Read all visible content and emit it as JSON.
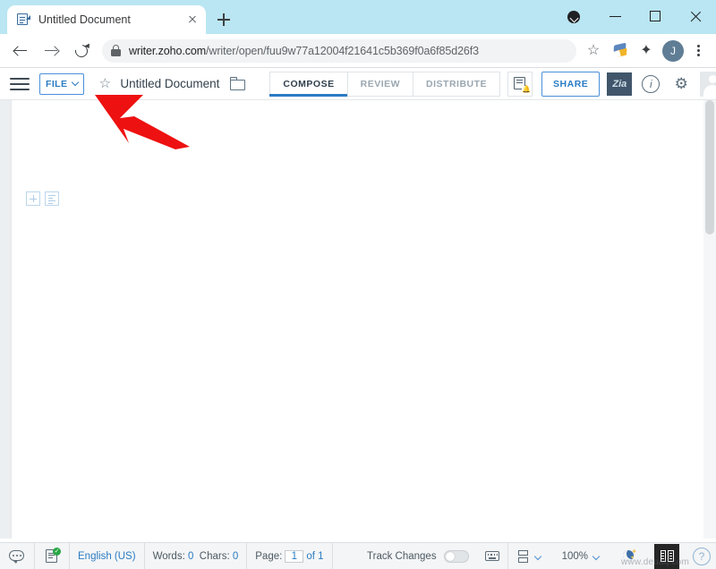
{
  "browser": {
    "tab": {
      "title": "Untitled Document",
      "favicon": "document-icon",
      "close": "×"
    },
    "new_tab_label": "+",
    "window_controls": {
      "tab_search": "tab-search-icon",
      "minimize": "−",
      "maximize": "□",
      "close": "×"
    },
    "nav": {
      "back": "back-arrow-icon",
      "forward": "forward-arrow-icon",
      "reload": "reload-icon"
    },
    "omnibox": {
      "lock": "lock-icon",
      "url_domain": "writer.zoho.com",
      "url_path": "/writer/open/fuu9w77a12004f21641c5b369f0a6f85d26f3",
      "bookmark_star": "☆"
    },
    "extensions": {
      "highlighter": "highlighter-extension-icon",
      "puzzle": "✦"
    },
    "profile_initial": "J",
    "menu": "kebab-menu-icon"
  },
  "app": {
    "menu_icon": "hamburger-menu-icon",
    "file_button": {
      "label": "FILE",
      "chevron": "chevron-down-icon"
    },
    "favorite_star": "☆",
    "document_title": "Untitled Document",
    "folder_icon": "folder-icon",
    "mode_tabs": [
      {
        "label": "COMPOSE",
        "active": true
      },
      {
        "label": "REVIEW",
        "active": false
      },
      {
        "label": "DISTRIBUTE",
        "active": false
      }
    ],
    "notifications_icon": "document-notification-icon",
    "share_button": "SHARE",
    "zia_button": "Zia",
    "info_icon": "i",
    "settings_icon": "⚙",
    "avatar": "user-avatar-icon"
  },
  "document": {
    "insert_tool": "add-block-icon",
    "paragraph_tool": "paragraph-settings-icon"
  },
  "annotation": {
    "arrow_color": "#ee1111",
    "points_to": "file-button"
  },
  "statusbar": {
    "comment_icon": "comment-icon",
    "spellcheck_icon": "spellcheck-ok-icon",
    "spellcheck_badge": "✓",
    "language": "English (US)",
    "words_label": "Words:",
    "words_value": "0",
    "chars_label": "Chars:",
    "chars_value": "0",
    "page_label": "Page:",
    "page_current": "1",
    "page_of": "of 1",
    "track_changes_label": "Track Changes",
    "track_changes_state": "off",
    "keyboard_icon": "keyboard-icon",
    "page_layout_icon": "page-layout-icon",
    "layout_chevron": "chevron-down-icon",
    "zoom_level": "100%",
    "zoom_chevron": "chevron-down-icon",
    "dark_mode_icon": "night-mode-icon",
    "reading_view_icon": "reading-view-icon",
    "help_icon": "?"
  },
  "watermark": "www.deuaq.com",
  "colors": {
    "titlebar": "#b9e6f2",
    "accent_blue": "#2b7cc4",
    "zia_dark": "#41566b",
    "annotation_red": "#ee1111",
    "doc_bg": "#eceff1"
  }
}
